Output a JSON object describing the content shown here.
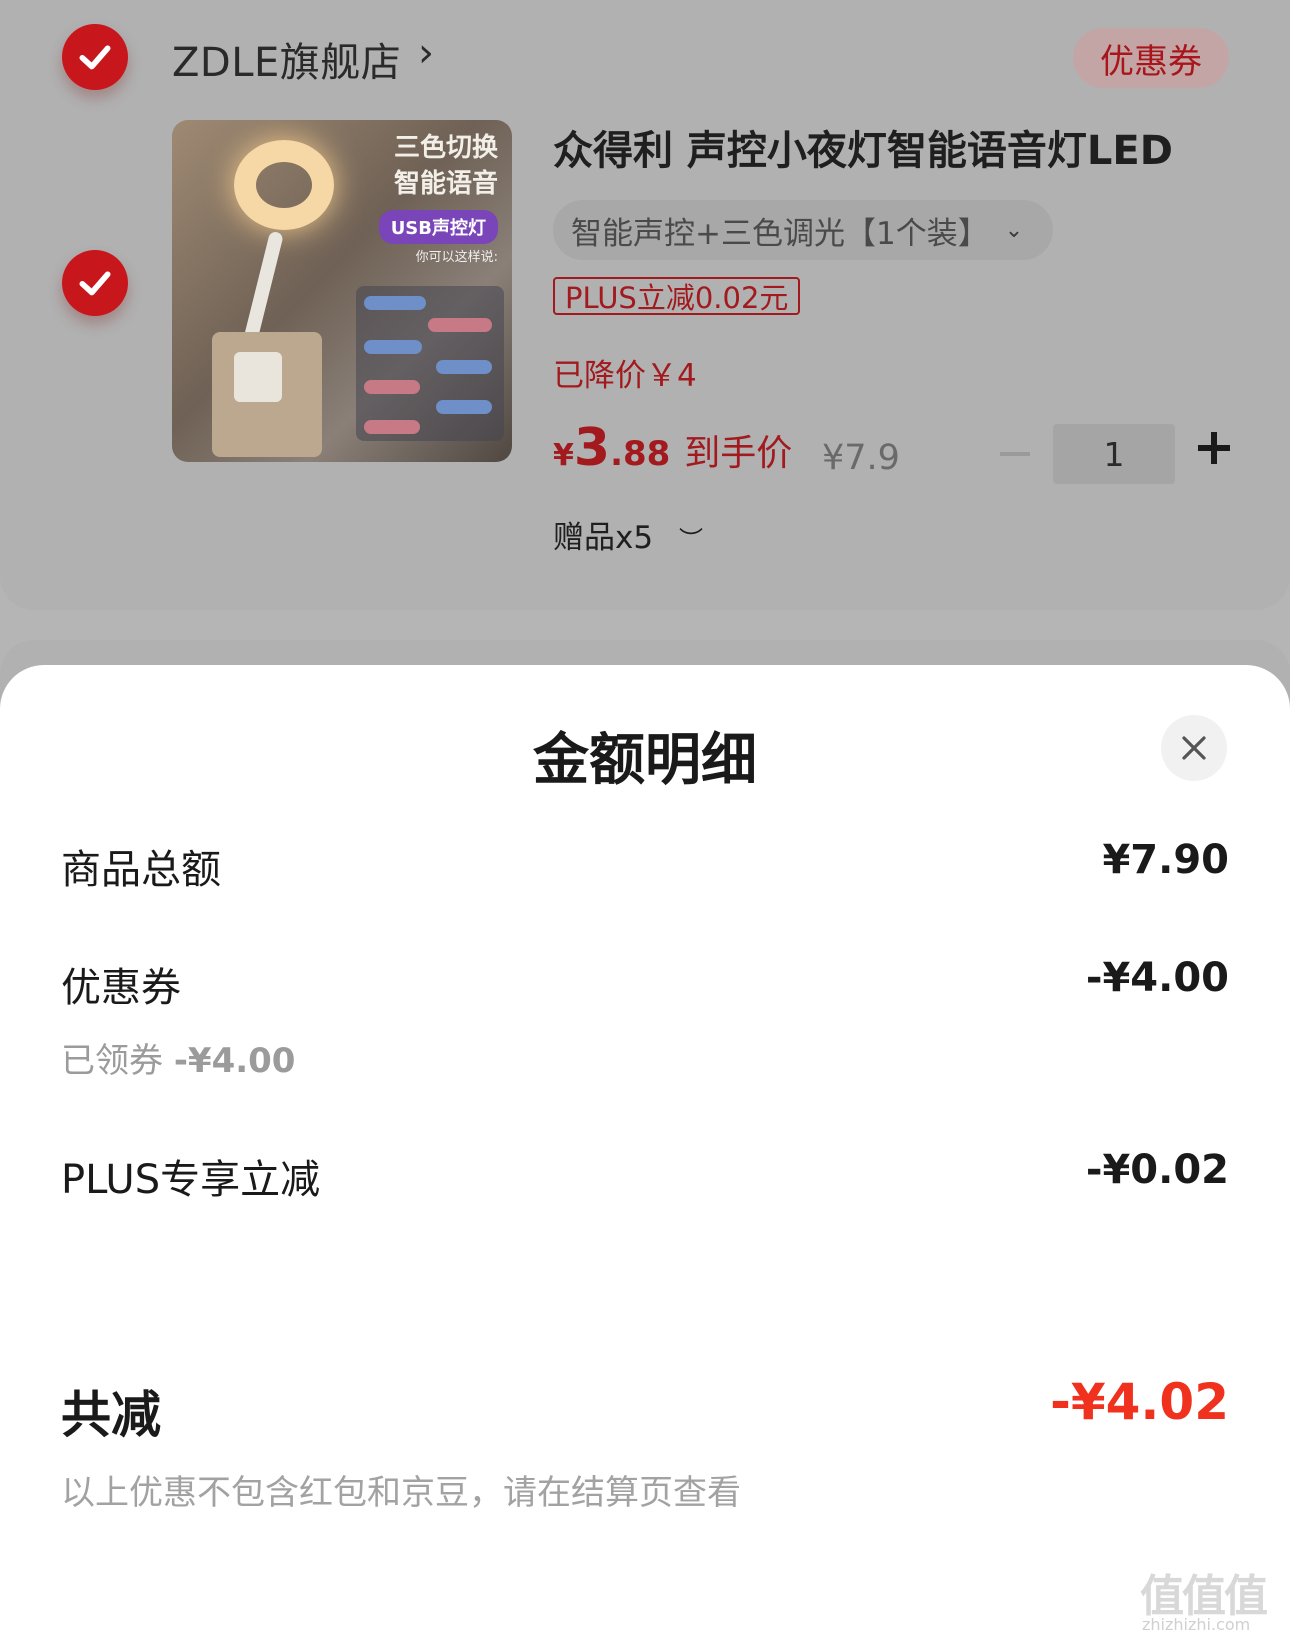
{
  "store": {
    "name": "ZDLE旗舰店",
    "arrow": "›",
    "coupon_label": "优惠券"
  },
  "product": {
    "title": "众得利 声控小夜灯智能语音灯LED",
    "spec": "智能声控+三色调光【1个装】",
    "plus_tag": "PLUS立减0.02元",
    "reduced": "已降价￥4",
    "price_yen": "¥",
    "price_int": "3",
    "price_dec": ".88",
    "price_label": "到手价",
    "orig_price": "¥7.9",
    "quantity": "1",
    "gift": "赠品x5",
    "image_text": {
      "line1": "三色切换",
      "line2": "智能语音",
      "pill": "USB声控灯",
      "small": "你可以这样说:"
    }
  },
  "sheet": {
    "title": "金额明细",
    "rows": [
      {
        "label": "商品总额",
        "value": "¥7.90"
      },
      {
        "label": "优惠券",
        "value": "-¥4.00"
      },
      {
        "label": "PLUS专享立减",
        "value": "-¥0.02"
      }
    ],
    "coupon_sub_label": "已领券",
    "coupon_sub_value": "-¥4.00",
    "total_label": "共减",
    "total_value": "-¥4.02",
    "note": "以上优惠不包含红包和京豆，请在结算页查看"
  },
  "watermark": {
    "logo": "值值值",
    "site": "zhizhizhi.com"
  },
  "colors": {
    "accent_red": "#f0311e",
    "dim_red": "#a21a1e",
    "check_red": "#c8161d"
  }
}
